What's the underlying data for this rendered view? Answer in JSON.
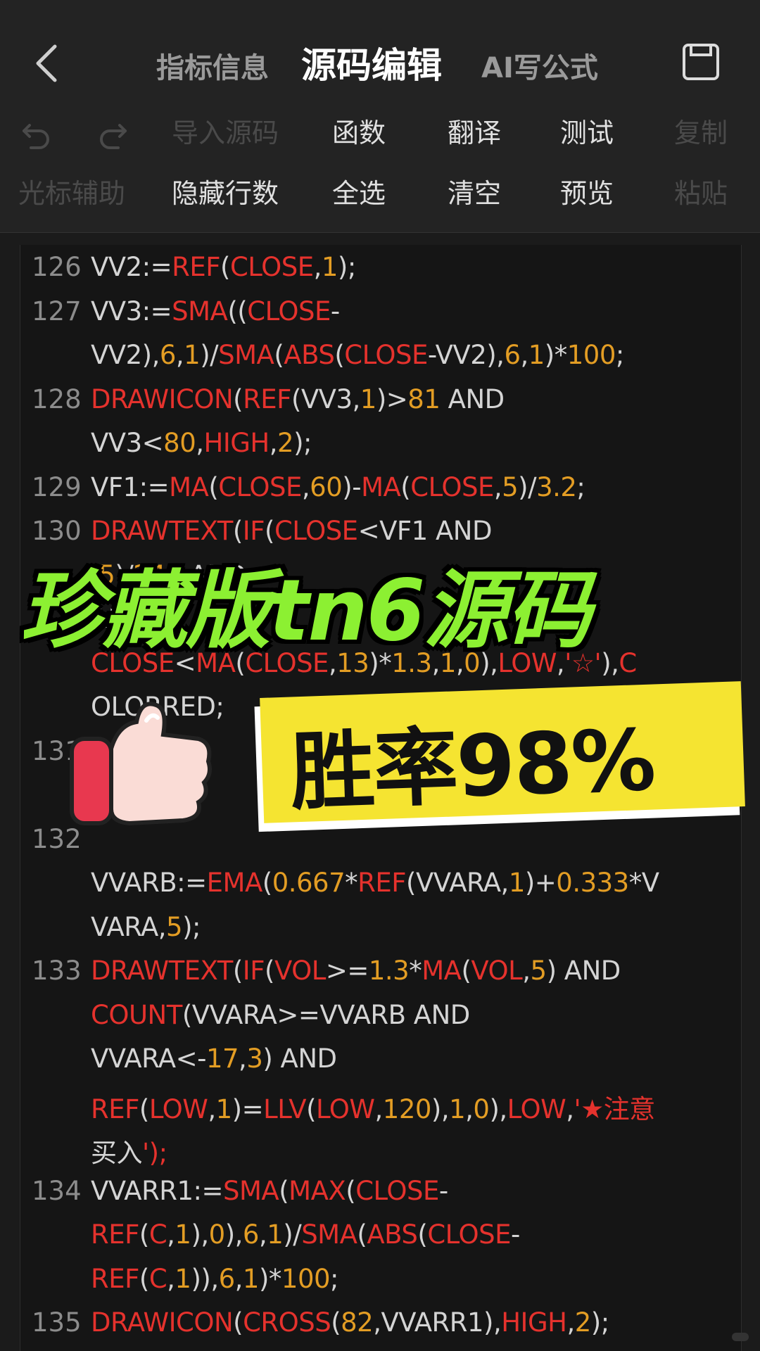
{
  "header": {
    "tabs": [
      {
        "label": "指标信息",
        "active": false
      },
      {
        "label": "源码编辑",
        "active": true
      },
      {
        "label": "AI写公式",
        "active": false
      }
    ]
  },
  "toolbar": {
    "row1": [
      {
        "label": "undo",
        "icon": "undo-icon",
        "disabled": true
      },
      {
        "label": "redo",
        "icon": "redo-icon",
        "disabled": true
      },
      {
        "label": "导入源码",
        "disabled": true
      },
      {
        "label": "函数",
        "disabled": false
      },
      {
        "label": "翻译",
        "disabled": false
      },
      {
        "label": "测试",
        "disabled": false
      },
      {
        "label": "复制",
        "disabled": true
      }
    ],
    "row2": [
      {
        "label": "光标辅助",
        "disabled": true
      },
      {
        "label": "隐藏行数",
        "disabled": false
      },
      {
        "label": "全选",
        "disabled": false
      },
      {
        "label": "清空",
        "disabled": false
      },
      {
        "label": "预览",
        "disabled": false
      },
      {
        "label": "粘贴",
        "disabled": true
      }
    ]
  },
  "editor": {
    "lines": [
      {
        "no": "126",
        "text": " VV2:=REF(CLOSE,1);"
      },
      {
        "no": "127",
        "text": " VV3:=SMA((CLOSE-"
      },
      {
        "no": "",
        "text": "VV2),6,1)/SMA(ABS(CLOSE-VV2),6,1)*100;"
      },
      {
        "no": "128",
        "text": " DRAWICON(REF(VV3,1)>81 AND"
      },
      {
        "no": "",
        "text": "VV3<80,HIGH,2);"
      },
      {
        "no": "129",
        "text": " VF1:=MA(CLOSE,60)-MA(CLOSE,5)/3.2;"
      },
      {
        "no": "130",
        "text": " DRAWTEXT(IF(CLOSE<VF1 AND"
      },
      {
        "no": "",
        "text": "                    ,5)/240 AND"
      },
      {
        "no": "",
        "text": "                                      AND"
      },
      {
        "no": "",
        "text": "CLOSE<MA(CLOSE,13)*1.3,1,0),LOW,'☆'),C"
      },
      {
        "no": "",
        "text": "OLORRED;"
      },
      {
        "no": "131",
        "text": "         :=(CL"
      },
      {
        "no": "",
        "text": "         N,2S"
      },
      {
        "no": "132",
        "text": ""
      },
      {
        "no": "",
        "text": "VVARB:=EMA(0.667*REF(VVARA,1)+0.333*V"
      },
      {
        "no": "",
        "text": "VARA,5);"
      },
      {
        "no": "133",
        "text": " DRAWTEXT(IF(VOL>=1.3*MA(VOL,5) AND"
      },
      {
        "no": "",
        "text": "COUNT(VVARA>=VVARB AND"
      },
      {
        "no": "",
        "text": "VVARA<-17,3) AND"
      },
      {
        "no": "",
        "text": "REF(LOW,1)=LLV(LOW,120),1,0),LOW,'★注意"
      },
      {
        "no": "",
        "text": "买入');"
      },
      {
        "no": "134",
        "text": "VVARR1:=SMA(MAX(CLOSE-"
      },
      {
        "no": "",
        "text": "REF(C,1),0),6,1)/SMA(ABS(CLOSE-"
      },
      {
        "no": "",
        "text": "REF(C,1)),6,1)*100;"
      },
      {
        "no": "135",
        "text": " DRAWICON(CROSS(82,VVARR1),HIGH,2);"
      }
    ]
  },
  "overlay": {
    "title": "珍藏版tn6源码",
    "win_rate": "胜率98%"
  },
  "colors": {
    "function": "#e5322d",
    "number": "#e39d24",
    "title_green": "#8cf032",
    "banner_yellow": "#f5e431"
  }
}
